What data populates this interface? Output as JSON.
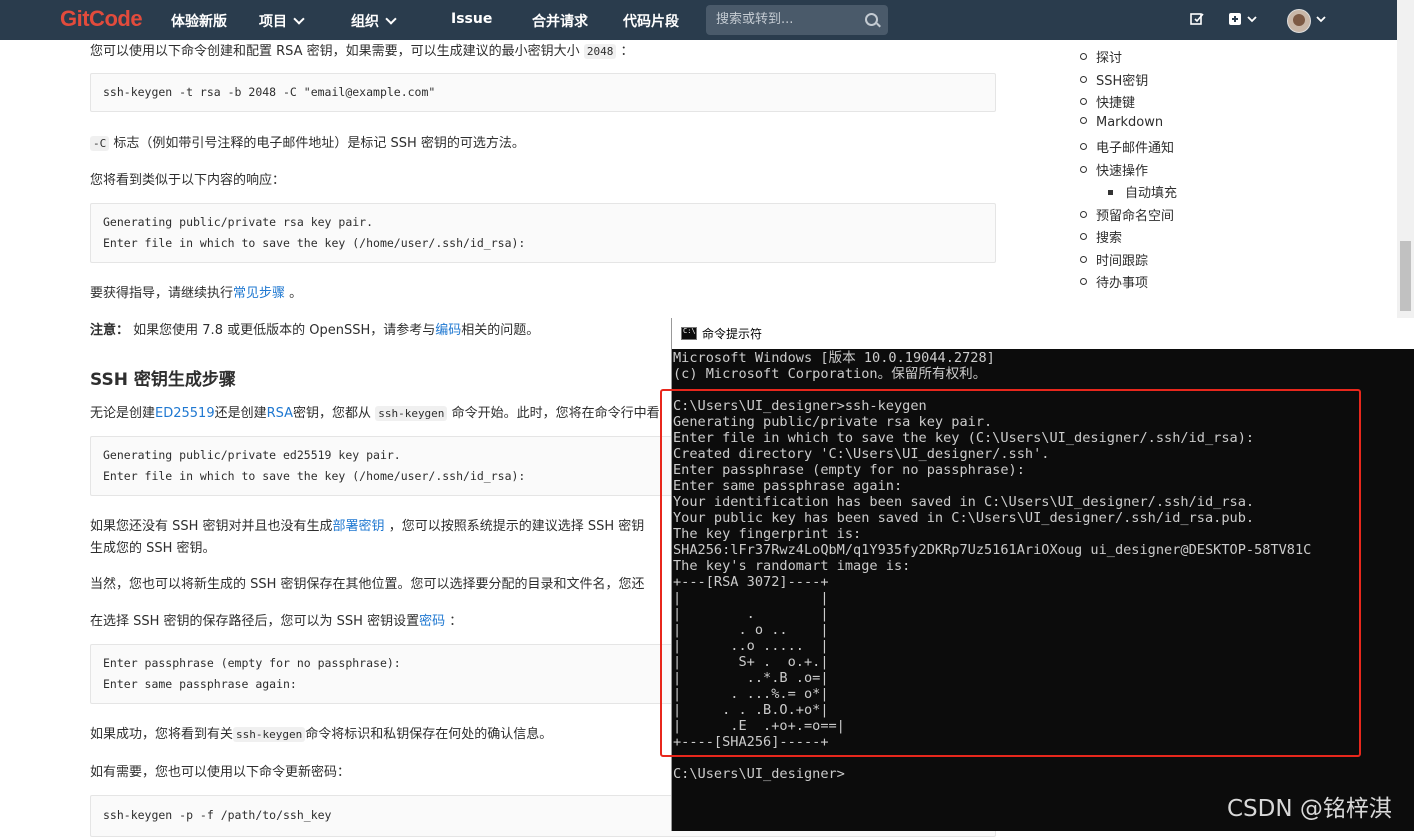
{
  "nav": {
    "logo": "GitCode",
    "items": [
      "体验新版",
      "项目",
      "组织",
      "Issue",
      "合并请求",
      "代码片段"
    ],
    "search_placeholder": "搜索或转到..."
  },
  "content": {
    "intro": "您可以使用以下命令创建和配置 RSA 密钥，如果需要，可以生成建议的最小密钥大小",
    "intro_code": "2048",
    "intro_end": "：",
    "code1": "ssh-keygen -t rsa -b 2048 -C \"email@example.com\"",
    "flag_code": "-C",
    "flag_text": "标志（例如带引号注释的电子邮件地址）是标记 SSH 密钥的可选方法。",
    "response_text": "您将看到类似于以下内容的响应：",
    "code2": [
      "Generating public/private rsa key pair.",
      "Enter file in which to save the key (/home/user/.ssh/id_rsa):"
    ],
    "guide_pre": "要获得指导，请继续执行",
    "guide_link": "常见步骤",
    "guide_post": "。",
    "note_label": "注意：",
    "note_pre": "如果您使用 7.8 或更低版本的 OpenSSH，请参考与",
    "note_link": "编码",
    "note_post": "相关的问题。",
    "heading": "SSH 密钥生成步骤",
    "para1_a": "无论是创建",
    "para1_link1": "ED25519",
    "para1_b": "还是创建",
    "para1_link2": "RSA",
    "para1_c": "密钥，您都从",
    "para1_code": "ssh-keygen",
    "para1_d": "命令开始。此时，您将在命令行中看",
    "code3": [
      "Generating public/private ed25519 key pair.",
      "Enter file in which to save the key (/home/user/.ssh/id_rsa):"
    ],
    "para2_a": "如果您还没有 SSH 密钥对并且也没有生成",
    "para2_link": "部署密钥",
    "para2_b": "，您可以按照系统提示的建议选择 SSH 密钥",
    "para2_line2": "生成您的 SSH 密钥。",
    "para3": "当然，您也可以将新生成的 SSH 密钥保存在其他位置。您可以选择要分配的目录和文件名，您还",
    "para4_a": "在选择 SSH 密钥的保存路径后，您可以为 SSH 密钥设置",
    "para4_link": "密码",
    "para4_b": "：",
    "code4": [
      "Enter passphrase (empty for no passphrase):",
      "Enter same passphrase again:"
    ],
    "para5_a": "如果成功，您将看到有关",
    "para5_code": "ssh-keygen",
    "para5_b": "命令将标识和私钥保存在何处的确认信息。",
    "para6": "如有需要，您也可以使用以下命令更新密码：",
    "code5": "ssh-keygen -p -f /path/to/ssh_key"
  },
  "toc": {
    "items": [
      "探讨",
      "SSH密钥",
      "快捷键",
      "Markdown",
      "电子邮件通知",
      "快速操作"
    ],
    "sub": "自动填充",
    "items2": [
      "预留命名空间",
      "搜索",
      "时间跟踪",
      "待办事项"
    ]
  },
  "cmd": {
    "title": "命令提示符",
    "lines": [
      "Microsoft Windows [版本 10.0.19044.2728]",
      "(c) Microsoft Corporation。保留所有权利。",
      "",
      "C:\\Users\\UI_designer>ssh-keygen",
      "Generating public/private rsa key pair.",
      "Enter file in which to save the key (C:\\Users\\UI_designer/.ssh/id_rsa):",
      "Created directory 'C:\\Users\\UI_designer/.ssh'.",
      "Enter passphrase (empty for no passphrase):",
      "Enter same passphrase again:",
      "Your identification has been saved in C:\\Users\\UI_designer/.ssh/id_rsa.",
      "Your public key has been saved in C:\\Users\\UI_designer/.ssh/id_rsa.pub.",
      "The key fingerprint is:",
      "SHA256:lFr37Rwz4LoQbM/q1Y935fy2DKRp7Uz5161AriOXoug ui_designer@DESKTOP-58TV81C",
      "The key's randomart image is:",
      "+---[RSA 3072]----+",
      "|                 |",
      "|        .        |",
      "|       . o ..    |",
      "|      ..o .....  |",
      "|       S+ .  o.+.|",
      "|        ..*.B .o=|",
      "|      . ...%.= o*|",
      "|     . . .B.O.+o*|",
      "|      .E  .+o+.=o==|",
      "+----[SHA256]-----+",
      "",
      "C:\\Users\\UI_designer>"
    ]
  },
  "watermark": "CSDN @铭梓淇"
}
